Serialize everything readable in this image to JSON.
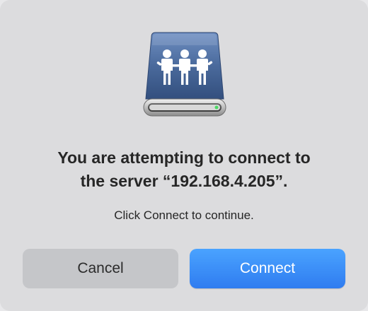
{
  "dialog": {
    "icon_name": "shared-server-drive-icon",
    "headline_line1": "You are attempting to connect to",
    "headline_line2": "the server “192.168.4.205”.",
    "subtext": "Click Connect to continue.",
    "buttons": {
      "cancel_label": "Cancel",
      "connect_label": "Connect"
    },
    "colors": {
      "background": "#dcdcde",
      "accent": "#2f7cf0",
      "cancel_bg": "#c5c6c9",
      "drive_body": "#4a6a9c",
      "status_led": "#4cd964"
    }
  }
}
